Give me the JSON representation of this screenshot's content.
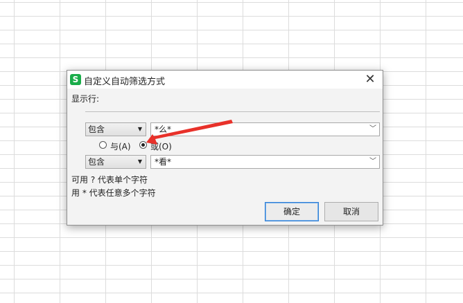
{
  "dialog": {
    "title": "自定义自动筛选方式",
    "app_icon_glyph": "S",
    "close_glyph": "✕",
    "show_rows_label": "显示行:",
    "condition1": {
      "operator": "包含",
      "value": "*么*"
    },
    "logic": {
      "and_label": "与(A)",
      "or_label": "或(O)",
      "selected": "or"
    },
    "condition2": {
      "operator": "包含",
      "value": "*看*"
    },
    "hint1": "可用 ? 代表单个字符",
    "hint2": "用 * 代表任意多个字符",
    "ok_label": "确定",
    "cancel_label": "取消"
  },
  "icons": {
    "app": "wps-spreadsheet-icon",
    "close": "close-icon",
    "dropdown": "dropdown-arrow-icon",
    "chevron": "chevron-down-icon",
    "annotation": "red-arrow-annotation"
  },
  "colors": {
    "app_icon": "#1aad4a",
    "annotation_arrow": "#e8312a",
    "primary_border": "#2f7fd6"
  }
}
